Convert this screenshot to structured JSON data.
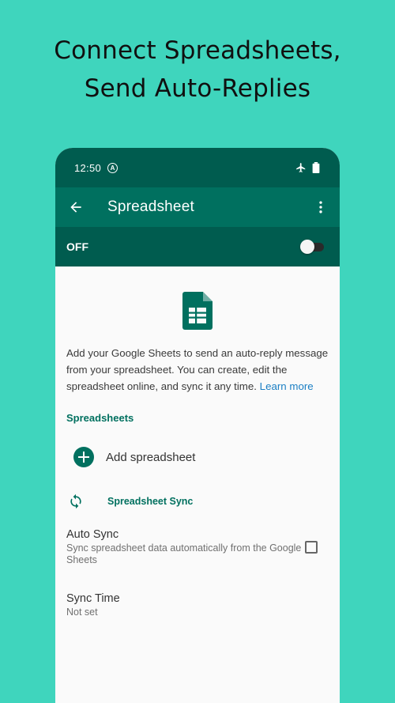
{
  "headline": {
    "line1": "Connect Spreadsheets,",
    "line2": "Send Auto-Replies"
  },
  "status_bar": {
    "time": "12:50",
    "a_badge": "A",
    "icons": [
      "auto-a-icon",
      "airplane-mode-icon",
      "battery-icon"
    ]
  },
  "app_bar": {
    "title": "Spreadsheet",
    "back_icon": "arrow-back-icon",
    "menu_icon": "more-vert-icon"
  },
  "toggle_bar": {
    "label": "OFF",
    "enabled": false
  },
  "content": {
    "description": "Add your Google Sheets to send an auto-reply message from your spreadsheet. You can create, edit the spreadsheet online, and sync it any time.",
    "learn_more": "Learn more",
    "spreadsheets_header": "Spreadsheets",
    "add_spreadsheet": "Add spreadsheet",
    "sync_header": "Spreadsheet Sync",
    "auto_sync": {
      "title": "Auto Sync",
      "summary": "Sync spreadsheet data automatically from the Google Sheets",
      "checked": false
    },
    "sync_time": {
      "title": "Sync Time",
      "summary": "Not set"
    }
  },
  "colors": {
    "background": "#3fd5bd",
    "primary": "#00705f",
    "primary_dark": "#005c4f",
    "link": "#1b7fc4"
  }
}
